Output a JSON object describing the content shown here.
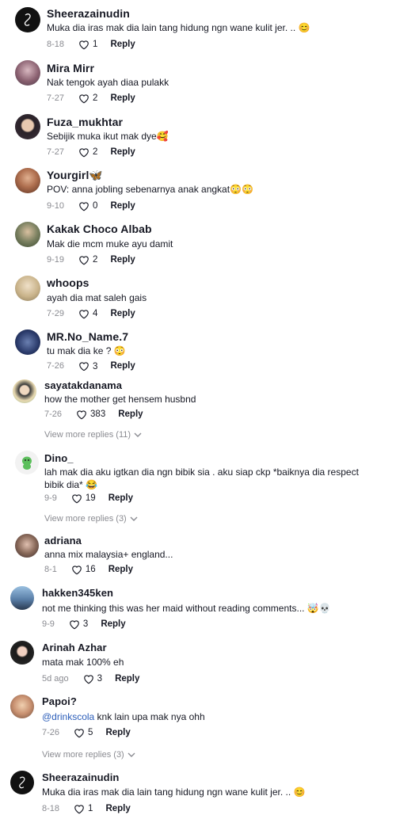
{
  "comments": [
    {
      "username": "Sheerazainudin",
      "text": "Muka dia iras mak dia lain tang hidung ngn wane kulit jer. .. 😊",
      "date": "8-18",
      "likes": "1",
      "reply": "Reply",
      "avatar_color": "#111111"
    },
    {
      "username": "Mira Mirr",
      "text": "Nak tengok ayah diaa pulakk",
      "date": "7-27",
      "likes": "2",
      "reply": "Reply",
      "avatar_color": "#6b4f5a"
    },
    {
      "username": "Fuza_mukhtar",
      "text": "Sebijik muka ikut mak dye🥰",
      "date": "7-27",
      "likes": "2",
      "reply": "Reply",
      "avatar_color": "#3a2f3a"
    },
    {
      "username": "Yourgirl🦋",
      "text": "POV: anna jobling sebenarnya anak angkat😳😳",
      "date": "9-10",
      "likes": "0",
      "reply": "Reply",
      "avatar_color": "#a0522d"
    },
    {
      "username": "Kakak Choco Albab",
      "text": "Mak die mcm muke ayu damit",
      "date": "9-19",
      "likes": "2",
      "reply": "Reply",
      "avatar_color": "#4a5a3a"
    },
    {
      "username": "whoops",
      "text": "ayah dia mat saleh gais",
      "date": "7-29",
      "likes": "4",
      "reply": "Reply",
      "avatar_color": "#c9b38a"
    },
    {
      "username": "MR.No_Name.7",
      "text": "tu mak dia ke ? 😳",
      "date": "7-26",
      "likes": "3",
      "reply": "Reply",
      "avatar_color": "#2a3a6a"
    },
    {
      "username": "sayatakdanama",
      "text": "how the mother get hensem husbnd",
      "date": "7-26",
      "likes": "383",
      "reply": "Reply",
      "avatar_color": "#e8d8b0"
    },
    {
      "username": "Dino_",
      "text": "lah mak dia aku igtkan dia ngn bibik sia . aku siap ckp *baiknya dia respect bibik dia* 😂",
      "date": "9-9",
      "likes": "19",
      "reply": "Reply",
      "avatar_color": "#f2f2f2"
    },
    {
      "username": "adriana",
      "text": "anna mix malaysia+ england...",
      "date": "8-1",
      "likes": "16",
      "reply": "Reply",
      "avatar_color": "#8a6a5a"
    },
    {
      "username": "hakken345ken",
      "text": "not me thinking this was her maid without reading comments... 🤯💀",
      "date": "9-9",
      "likes": "3",
      "reply": "Reply",
      "avatar_color": "#5a7fa8"
    },
    {
      "username": "Arinah Azhar",
      "text": "mata mak 100% eh",
      "date": "5d ago",
      "likes": "3",
      "reply": "Reply",
      "avatar_color": "#2a2a2a"
    },
    {
      "username": "Papoi?",
      "mention": "@drinkscola",
      "text": " knk lain upa mak nya ohh",
      "date": "7-26",
      "likes": "5",
      "reply": "Reply",
      "avatar_color": "#b88a6a"
    },
    {
      "username": "Sheerazainudin",
      "text": "Muka dia iras mak dia lain tang hidung ngn wane kulit jer. .. 😊",
      "date": "8-18",
      "likes": "1",
      "reply": "Reply",
      "avatar_color": "#111111"
    }
  ],
  "view_more": [
    {
      "label": "View more replies (11)"
    },
    {
      "label": "View more replies (3)"
    },
    {
      "label": "View more replies (3)"
    }
  ],
  "icons": {
    "like": "heart-outline-icon",
    "expand": "chevron-down-icon"
  }
}
